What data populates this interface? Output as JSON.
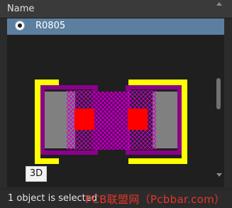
{
  "table": {
    "column_header": "Name",
    "selected_row": {
      "label": "R0805",
      "selected": true
    }
  },
  "preview": {
    "toggle_3d_label": "3D",
    "colors": {
      "background": "#1f1f1f",
      "silkscreen": "#ffff00",
      "body": "#808080",
      "pad_outline": "#8b008b",
      "pad": "#ff0000",
      "courtyard_hatch": "#cc00cc"
    }
  },
  "status": {
    "text": "1 object is selected"
  },
  "watermark": {
    "text": "PCB联盟网（Pcbbar.com）"
  }
}
